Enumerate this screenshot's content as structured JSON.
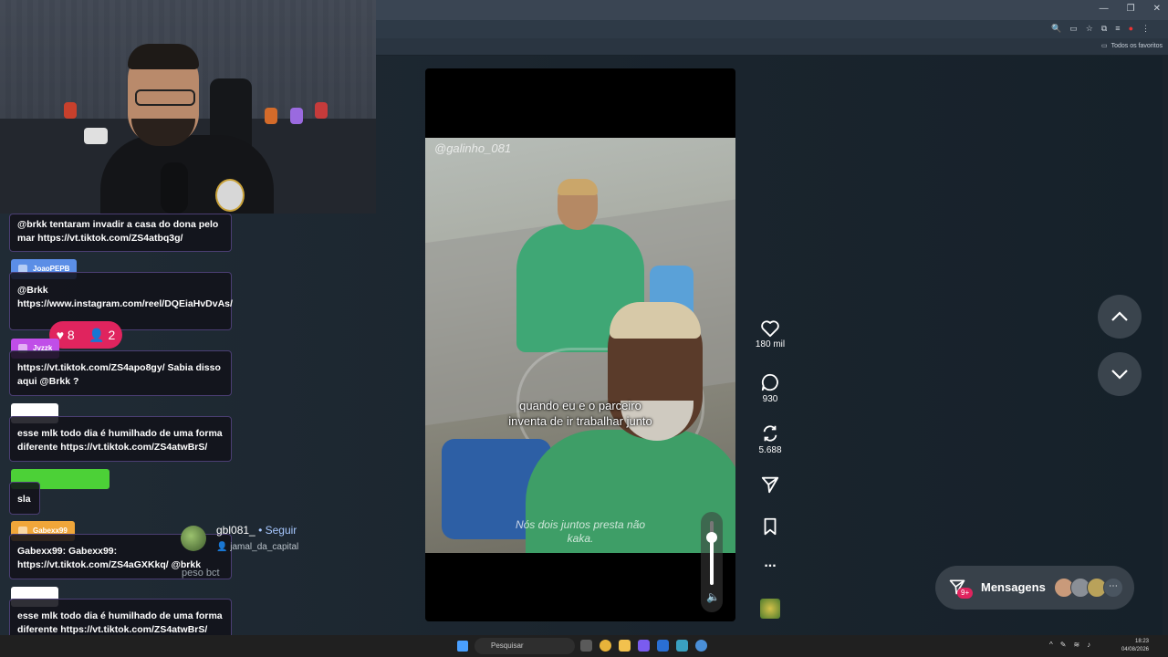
{
  "browser": {
    "bookmarks_label": "Todos os favoritos"
  },
  "chat": {
    "messages": [
      {
        "text": "@brkk tentaram invadir a casa do dona pelo mar https://vt.tiktok.com/ZS4atbq3g/"
      },
      {
        "user": "JoaoPEPB",
        "text": "@Brkk https://www.instagram.com/reel/DQEiaHvDvAs/"
      },
      {
        "user": "Jvzzk",
        "text": "https://vt.tiktok.com/ZS4apo8gy/ Sabia disso aqui @Brkk ?"
      },
      {
        "user": "",
        "text": "esse mlk todo dia é humilhado de uma forma diferente https://vt.tiktok.com/ZS4atwBrS/"
      },
      {
        "user": "",
        "text": "sla"
      },
      {
        "user": "Gabexx99",
        "text": "Gabexx99: Gabexx99: https://vt.tiktok.com/ZS4aGXKkq/ @brkk"
      },
      {
        "user": "",
        "text": "esse mlk todo dia é humilhado de uma forma diferente https://vt.tiktok.com/ZS4atwBrS/"
      }
    ],
    "reactions": {
      "likes": "8",
      "viewers": "2"
    },
    "colors": {
      "JoaoPEPB": "#5b8ee6",
      "Jvzzk": "#c04ee8",
      "green_tag": "#4cd137",
      "Gabexx99": "#f0a63a"
    }
  },
  "post": {
    "author": "gbl081_",
    "follow_label": "Seguir",
    "sound": "jamal_da_capital",
    "description": "peso bct",
    "watermark": "@galinho_081",
    "caption_line1": "quando eu e o parceiro",
    "caption_line2": "inventa de ir trabalhar junto",
    "subtitle_line1": "Nós dois juntos presta não",
    "subtitle_line2": "kaka."
  },
  "actions": {
    "likes": "180 mil",
    "comments": "930",
    "reposts": "5.688",
    "more": "..."
  },
  "messages_widget": {
    "label": "Mensagens",
    "badge": "9+"
  },
  "taskbar": {
    "search_placeholder": "Pesquisar",
    "time": "18:23",
    "date": "04/08/2026"
  }
}
